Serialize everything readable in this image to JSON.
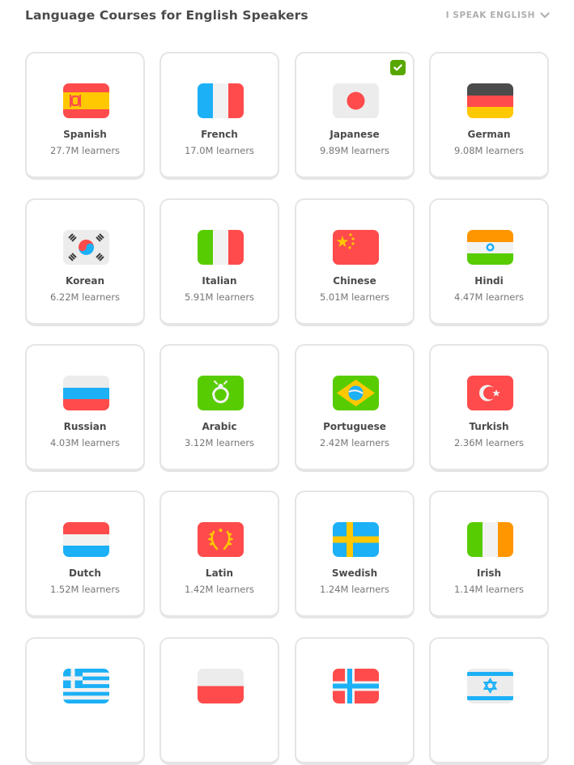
{
  "header": {
    "title": "Language Courses for English Speakers",
    "speak_label": "I SPEAK ENGLISH"
  },
  "courses": [
    {
      "name": "Spanish",
      "learners": "27.7M learners",
      "flag": "spain-flag"
    },
    {
      "name": "French",
      "learners": "17.0M learners",
      "flag": "france-flag"
    },
    {
      "name": "Japanese",
      "learners": "9.89M learners",
      "flag": "japan-flag",
      "selected": true
    },
    {
      "name": "German",
      "learners": "9.08M learners",
      "flag": "germany-flag"
    },
    {
      "name": "Korean",
      "learners": "6.22M learners",
      "flag": "korea-flag"
    },
    {
      "name": "Italian",
      "learners": "5.91M learners",
      "flag": "italy-flag"
    },
    {
      "name": "Chinese",
      "learners": "5.01M learners",
      "flag": "china-flag"
    },
    {
      "name": "Hindi",
      "learners": "4.47M learners",
      "flag": "india-flag"
    },
    {
      "name": "Russian",
      "learners": "4.03M learners",
      "flag": "russia-flag"
    },
    {
      "name": "Arabic",
      "learners": "3.12M learners",
      "flag": "arabic-flag"
    },
    {
      "name": "Portuguese",
      "learners": "2.42M learners",
      "flag": "brazil-flag"
    },
    {
      "name": "Turkish",
      "learners": "2.36M learners",
      "flag": "turkey-flag"
    },
    {
      "name": "Dutch",
      "learners": "1.52M learners",
      "flag": "netherlands-flag"
    },
    {
      "name": "Latin",
      "learners": "1.42M learners",
      "flag": "latin-flag"
    },
    {
      "name": "Swedish",
      "learners": "1.24M learners",
      "flag": "sweden-flag"
    },
    {
      "name": "Irish",
      "learners": "1.14M learners",
      "flag": "ireland-flag"
    },
    {
      "name": "",
      "learners": "",
      "flag": "greece-flag"
    },
    {
      "name": "",
      "learners": "",
      "flag": "poland-flag"
    },
    {
      "name": "",
      "learners": "",
      "flag": "norway-flag"
    },
    {
      "name": "",
      "learners": "",
      "flag": "israel-flag"
    }
  ],
  "colors": {
    "card_border": "#e5e5e5",
    "selected_check": "#58a700"
  }
}
